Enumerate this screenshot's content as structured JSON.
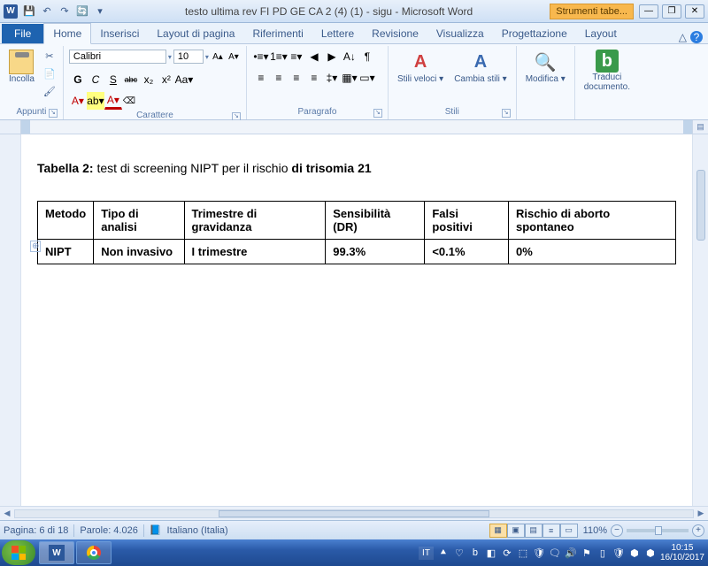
{
  "titlebar": {
    "app_letter": "W",
    "title": "testo ultima rev FI PD GE CA 2 (4) (1) - sigu  -  Microsoft Word",
    "table_tools": "Strumenti tabe..."
  },
  "qat": [
    "💾",
    "↶",
    "↷",
    "🔄",
    "▾"
  ],
  "win": {
    "min": "—",
    "max": "❐",
    "close": "✕"
  },
  "tabs": {
    "file": "File",
    "items": [
      "Home",
      "Inserisci",
      "Layout di pagina",
      "Riferimenti",
      "Lettere",
      "Revisione",
      "Visualizza",
      "Progettazione",
      "Layout"
    ],
    "active": "Home",
    "help_min": "△",
    "help_q": "?"
  },
  "ribbon": {
    "clipboard": {
      "paste": "Incolla",
      "label": "Appunti",
      "cut": "✂",
      "copy": "📄",
      "brush": "🖌"
    },
    "font": {
      "name": "Calibri",
      "size": "10",
      "grow": "A▴",
      "shrink": "A▾",
      "case": "Aa▾",
      "clear": "⌫",
      "bold": "G",
      "italic": "C",
      "underline": "S",
      "strike": "abc",
      "sub": "x₂",
      "sup": "x²",
      "effects": "A▾",
      "highlight": "ab▾",
      "color": "A▾",
      "label": "Carattere"
    },
    "paragraph": {
      "bullets": "•≡▾",
      "numbers": "1≡▾",
      "multilevel": "≡▾",
      "dedent": "◀",
      "indent": "▶",
      "sort": "A↓",
      "marks": "¶",
      "al": "≡",
      "ac": "≡",
      "ar": "≡",
      "aj": "≡",
      "spacing": "‡▾",
      "shading": "▦▾",
      "borders": "▭▾",
      "label": "Paragrafo"
    },
    "styles": {
      "quick": "Stili veloci ▾",
      "change": "Cambia stili ▾",
      "label": "Stili",
      "quick_ico": "A",
      "change_ico": "A"
    },
    "editing": {
      "label": "Modifica ▾",
      "ico": "🔍"
    },
    "translate": {
      "line1": "Traduci",
      "line2": "documento.",
      "ico": "b"
    }
  },
  "document": {
    "heading_prefix": "Tabella 2: ",
    "heading_mid": "test di screening NIPT per il rischio ",
    "heading_bold": "di trisomia 21",
    "anchor": "⊕",
    "headers": [
      "Metodo",
      "Tipo di analisi",
      "Trimestre di gravidanza",
      "Sensibilità (DR)",
      "Falsi positivi",
      "Rischio di aborto spontaneo"
    ],
    "row": [
      "NIPT",
      "Non invasivo",
      "I trimestre",
      "99.3%",
      "<0.1%",
      "0%"
    ]
  },
  "status": {
    "page": "Pagina: 6 di 18",
    "words": "Parole: 4.026",
    "proof_ico": "📘",
    "lang": "Italiano (Italia)",
    "zoom_pct": "110%"
  },
  "taskbar": {
    "lang": "IT",
    "tray_icons": [
      "⯅",
      "♡",
      "b",
      "◧",
      "⟳",
      "⬚",
      "🛡",
      "🗨",
      "🔊",
      "⚑",
      "▯",
      "🛡",
      "⬢",
      "⬢"
    ],
    "time": "10:15",
    "date": "16/10/2017"
  }
}
